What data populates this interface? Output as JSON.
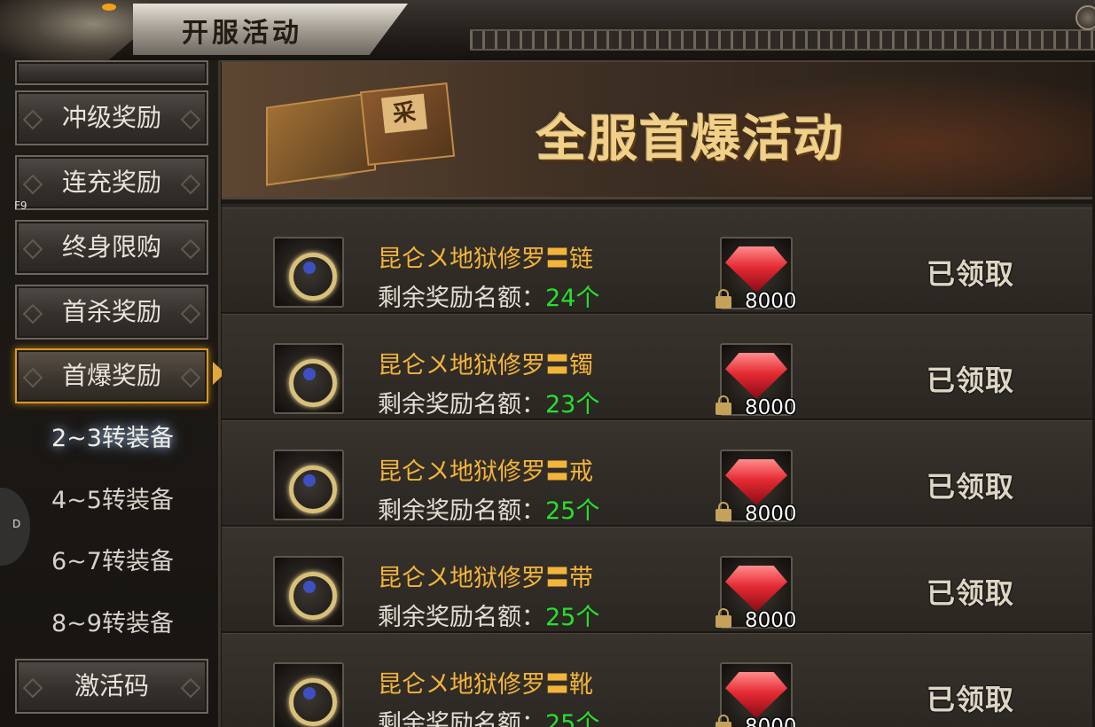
{
  "window": {
    "title": "开服活动"
  },
  "shortcuts": {
    "f9_label": "F9",
    "d_label": "D"
  },
  "sidebar": {
    "items": [
      {
        "label": "冲级奖励"
      },
      {
        "label": "连充奖励"
      },
      {
        "label": "终身限购"
      },
      {
        "label": "首杀奖励"
      },
      {
        "label": "首爆奖励",
        "active": true
      }
    ],
    "sub_items": [
      {
        "label": "2~3转装备",
        "selected": true
      },
      {
        "label": "4~5转装备"
      },
      {
        "label": "6~7转装备"
      },
      {
        "label": "8~9转装备"
      }
    ],
    "bottom_item": {
      "label": "激活码"
    }
  },
  "banner": {
    "title": "全服首爆活动",
    "box_char": "采"
  },
  "quota_label": "剩余奖励名额：",
  "rows": [
    {
      "item_name": "昆仑〤地狱修罗〓链",
      "count": "24个",
      "reward_amount": "8000",
      "status": "已领取",
      "icon": "necklace-icon"
    },
    {
      "item_name": "昆仑〤地狱修罗〓镯",
      "count": "23个",
      "reward_amount": "8000",
      "status": "已领取",
      "icon": "bracelet-icon"
    },
    {
      "item_name": "昆仑〤地狱修罗〓戒",
      "count": "25个",
      "reward_amount": "8000",
      "status": "已领取",
      "icon": "ring-icon"
    },
    {
      "item_name": "昆仑〤地狱修罗〓带",
      "count": "25个",
      "reward_amount": "8000",
      "status": "已领取",
      "icon": "belt-icon"
    },
    {
      "item_name": "昆仑〤地狱修罗〓靴",
      "count": "25个",
      "reward_amount": "8000",
      "status": "已领取",
      "icon": "boots-icon"
    }
  ],
  "colors": {
    "accent_gold": "#f3b43a",
    "count_green": "#27e02c",
    "active_border": "#d59a2a"
  }
}
